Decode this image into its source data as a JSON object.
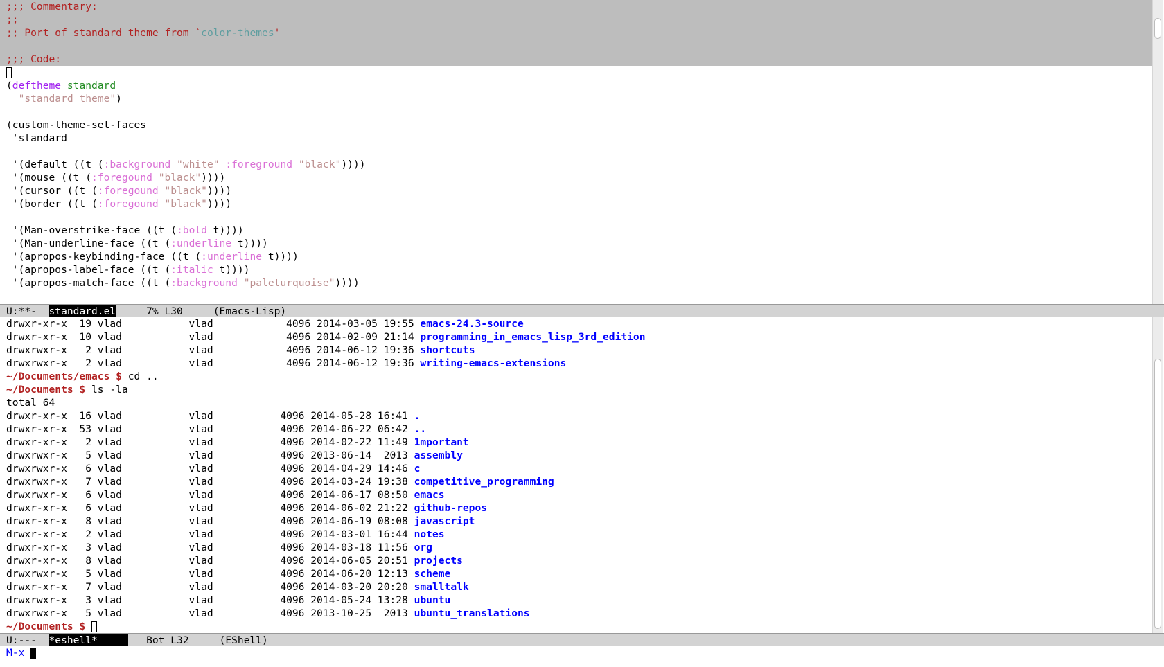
{
  "editor": {
    "commentary": [
      {
        "parts": [
          {
            "t": ";;; Commentary:",
            "c": "comment"
          }
        ]
      },
      {
        "parts": [
          {
            "t": ";;",
            "c": "comment"
          }
        ]
      },
      {
        "parts": [
          {
            "t": ";; Port of standard theme from `",
            "c": "comment"
          },
          {
            "t": "color-themes",
            "c": "constant"
          },
          {
            "t": "'",
            "c": "comment"
          }
        ]
      },
      {
        "parts": []
      },
      {
        "parts": [
          {
            "t": ";;; Code:",
            "c": "comment"
          }
        ]
      }
    ],
    "code": [
      {
        "parts": [],
        "cursor": true
      },
      {
        "parts": [
          {
            "t": "(",
            "c": ""
          },
          {
            "t": "deftheme",
            "c": "keyword"
          },
          {
            "t": " ",
            "c": ""
          },
          {
            "t": "standard",
            "c": "name"
          }
        ]
      },
      {
        "parts": [
          {
            "t": "  ",
            "c": ""
          },
          {
            "t": "\"standard theme\"",
            "c": "string"
          },
          {
            "t": ")",
            "c": ""
          }
        ]
      },
      {
        "parts": []
      },
      {
        "parts": [
          {
            "t": "(custom-theme-set-faces",
            "c": ""
          }
        ]
      },
      {
        "parts": [
          {
            "t": " 'standard",
            "c": ""
          }
        ]
      },
      {
        "parts": []
      },
      {
        "parts": [
          {
            "t": " '(default ((t (",
            "c": ""
          },
          {
            "t": ":background",
            "c": "builtin"
          },
          {
            "t": " ",
            "c": ""
          },
          {
            "t": "\"white\"",
            "c": "string"
          },
          {
            "t": " ",
            "c": ""
          },
          {
            "t": ":foreground",
            "c": "builtin"
          },
          {
            "t": " ",
            "c": ""
          },
          {
            "t": "\"black\"",
            "c": "string"
          },
          {
            "t": "))))",
            "c": ""
          }
        ]
      },
      {
        "parts": [
          {
            "t": " '(mouse ((t (",
            "c": ""
          },
          {
            "t": ":foregound",
            "c": "builtin"
          },
          {
            "t": " ",
            "c": ""
          },
          {
            "t": "\"black\"",
            "c": "string"
          },
          {
            "t": "))))",
            "c": ""
          }
        ]
      },
      {
        "parts": [
          {
            "t": " '(cursor ((t (",
            "c": ""
          },
          {
            "t": ":foregound",
            "c": "builtin"
          },
          {
            "t": " ",
            "c": ""
          },
          {
            "t": "\"black\"",
            "c": "string"
          },
          {
            "t": "))))",
            "c": ""
          }
        ]
      },
      {
        "parts": [
          {
            "t": " '(border ((t (",
            "c": ""
          },
          {
            "t": ":foregound",
            "c": "builtin"
          },
          {
            "t": " ",
            "c": ""
          },
          {
            "t": "\"black\"",
            "c": "string"
          },
          {
            "t": "))))",
            "c": ""
          }
        ]
      },
      {
        "parts": []
      },
      {
        "parts": [
          {
            "t": " '(Man-overstrike-face ((t (",
            "c": ""
          },
          {
            "t": ":bold",
            "c": "builtin"
          },
          {
            "t": " t))))",
            "c": ""
          }
        ]
      },
      {
        "parts": [
          {
            "t": " '(Man-underline-face ((t (",
            "c": ""
          },
          {
            "t": ":underline",
            "c": "builtin"
          },
          {
            "t": " t))))",
            "c": ""
          }
        ]
      },
      {
        "parts": [
          {
            "t": " '(apropos-keybinding-face ((t (",
            "c": ""
          },
          {
            "t": ":underline",
            "c": "builtin"
          },
          {
            "t": " t))))",
            "c": ""
          }
        ]
      },
      {
        "parts": [
          {
            "t": " '(apropos-label-face ((t (",
            "c": ""
          },
          {
            "t": ":italic",
            "c": "builtin"
          },
          {
            "t": " t))))",
            "c": ""
          }
        ]
      },
      {
        "parts": [
          {
            "t": " '(apropos-match-face ((t (",
            "c": ""
          },
          {
            "t": ":background",
            "c": "builtin"
          },
          {
            "t": " ",
            "c": ""
          },
          {
            "t": "\"paleturquoise\"",
            "c": "string"
          },
          {
            "t": "))))",
            "c": ""
          }
        ]
      }
    ]
  },
  "mode_line_top": {
    "status": "U:**-  ",
    "buffer": "standard.el",
    "position": "     7% L30     ",
    "mode": "(Emacs-Lisp)"
  },
  "shell": {
    "lines": [
      {
        "type": "ls",
        "perm": "drwxr-xr-x",
        "links": "19",
        "owner": "vlad",
        "group": "vlad",
        "size": "4096",
        "date": "2014-03-05",
        "time": "19:55",
        "name": "emacs-24.3-source"
      },
      {
        "type": "ls",
        "perm": "drwxr-xr-x",
        "links": "10",
        "owner": "vlad",
        "group": "vlad",
        "size": "4096",
        "date": "2014-02-09",
        "time": "21:14",
        "name": "programming_in_emacs_lisp_3rd_edition"
      },
      {
        "type": "ls",
        "perm": "drwxrwxr-x",
        "links": "2",
        "owner": "vlad",
        "group": "vlad",
        "size": "4096",
        "date": "2014-06-12",
        "time": "19:36",
        "name": "shortcuts"
      },
      {
        "type": "ls",
        "perm": "drwxrwxr-x",
        "links": "2",
        "owner": "vlad",
        "group": "vlad",
        "size": "4096",
        "date": "2014-06-12",
        "time": "19:36",
        "name": "writing-emacs-extensions"
      },
      {
        "type": "prompt",
        "prompt": "~/Documents/emacs $",
        "cmd": " cd .."
      },
      {
        "type": "prompt",
        "prompt": "~/Documents $",
        "cmd": " ls -la"
      },
      {
        "type": "text",
        "text": "total 64"
      },
      {
        "type": "ls2",
        "perm": "drwxr-xr-x",
        "links": "16",
        "owner": "vlad",
        "group": "vlad",
        "size": "4096",
        "date": "2014-05-28",
        "time": "16:41",
        "name": "."
      },
      {
        "type": "ls2",
        "perm": "drwxr-xr-x",
        "links": "53",
        "owner": "vlad",
        "group": "vlad",
        "size": "4096",
        "date": "2014-06-22",
        "time": "06:42",
        "name": ".."
      },
      {
        "type": "ls2",
        "perm": "drwxr-xr-x",
        "links": "2",
        "owner": "vlad",
        "group": "vlad",
        "size": "4096",
        "date": "2014-02-22",
        "time": "11:49",
        "name": "1mportant"
      },
      {
        "type": "ls2",
        "perm": "drwxrwxr-x",
        "links": "5",
        "owner": "vlad",
        "group": "vlad",
        "size": "4096",
        "date": "2013-06-14",
        "time": " 2013",
        "name": "assembly"
      },
      {
        "type": "ls2",
        "perm": "drwxrwxr-x",
        "links": "6",
        "owner": "vlad",
        "group": "vlad",
        "size": "4096",
        "date": "2014-04-29",
        "time": "14:46",
        "name": "c"
      },
      {
        "type": "ls2",
        "perm": "drwxrwxr-x",
        "links": "7",
        "owner": "vlad",
        "group": "vlad",
        "size": "4096",
        "date": "2014-03-24",
        "time": "19:38",
        "name": "competitive_programming"
      },
      {
        "type": "ls2",
        "perm": "drwxrwxr-x",
        "links": "6",
        "owner": "vlad",
        "group": "vlad",
        "size": "4096",
        "date": "2014-06-17",
        "time": "08:50",
        "name": "emacs"
      },
      {
        "type": "ls2",
        "perm": "drwxr-xr-x",
        "links": "6",
        "owner": "vlad",
        "group": "vlad",
        "size": "4096",
        "date": "2014-06-02",
        "time": "21:22",
        "name": "github-repos"
      },
      {
        "type": "ls2",
        "perm": "drwxr-xr-x",
        "links": "8",
        "owner": "vlad",
        "group": "vlad",
        "size": "4096",
        "date": "2014-06-19",
        "time": "08:08",
        "name": "javascript"
      },
      {
        "type": "ls2",
        "perm": "drwxr-xr-x",
        "links": "2",
        "owner": "vlad",
        "group": "vlad",
        "size": "4096",
        "date": "2014-03-01",
        "time": "16:44",
        "name": "notes"
      },
      {
        "type": "ls2",
        "perm": "drwxr-xr-x",
        "links": "3",
        "owner": "vlad",
        "group": "vlad",
        "size": "4096",
        "date": "2014-03-18",
        "time": "11:56",
        "name": "org"
      },
      {
        "type": "ls2",
        "perm": "drwxr-xr-x",
        "links": "8",
        "owner": "vlad",
        "group": "vlad",
        "size": "4096",
        "date": "2014-06-05",
        "time": "20:51",
        "name": "projects"
      },
      {
        "type": "ls2",
        "perm": "drwxrwxr-x",
        "links": "5",
        "owner": "vlad",
        "group": "vlad",
        "size": "4096",
        "date": "2014-06-20",
        "time": "12:13",
        "name": "scheme"
      },
      {
        "type": "ls2",
        "perm": "drwxr-xr-x",
        "links": "7",
        "owner": "vlad",
        "group": "vlad",
        "size": "4096",
        "date": "2014-03-20",
        "time": "20:20",
        "name": "smalltalk"
      },
      {
        "type": "ls2",
        "perm": "drwxrwxr-x",
        "links": "3",
        "owner": "vlad",
        "group": "vlad",
        "size": "4096",
        "date": "2014-05-24",
        "time": "13:28",
        "name": "ubuntu"
      },
      {
        "type": "ls2",
        "perm": "drwxrwxr-x",
        "links": "5",
        "owner": "vlad",
        "group": "vlad",
        "size": "4096",
        "date": "2013-10-25",
        "time": " 2013",
        "name": "ubuntu_translations"
      },
      {
        "type": "prompt",
        "prompt": "~/Documents $",
        "cmd": " ",
        "cursor": true
      }
    ]
  },
  "mode_line_bottom": {
    "status": "U:---  ",
    "buffer": "*eshell*     ",
    "position": "   Bot L32     ",
    "mode": "(EShell)"
  },
  "minibuffer": {
    "text": "M-x "
  },
  "colors": {
    "comment": "#b22222",
    "constant": "#5f9ea0",
    "keyword": "#a020f0",
    "name": "#228b22",
    "string": "#bc8f8f",
    "builtin": "#da70d6",
    "directory": "#0000ff",
    "prompt": "#b22222"
  }
}
